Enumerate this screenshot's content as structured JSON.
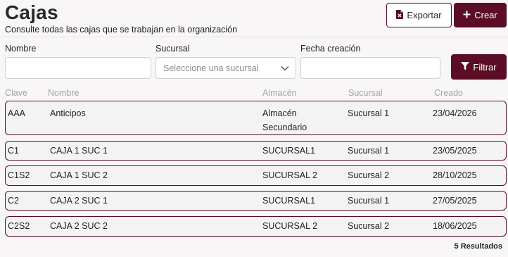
{
  "header": {
    "title": "Cajas",
    "subtitle": "Consulte todas las cajas que se trabajan en la organización",
    "export_label": "Exportar",
    "export_icon": "file-export-icon",
    "create_label": "Crear",
    "create_icon": "plus-icon"
  },
  "filters": {
    "nombre_label": "Nombre",
    "nombre_value": "",
    "sucursal_label": "Sucursal",
    "sucursal_placeholder": "Seleccione una sucursal",
    "fecha_label": "Fecha creación",
    "fecha_value": "",
    "filter_button_label": "Filtrar",
    "filter_icon": "funnel-icon"
  },
  "table": {
    "columns": [
      "Clave",
      "Nombre",
      "Almacén",
      "Sucursal",
      "Creado"
    ],
    "rows": [
      {
        "clave": "AAA",
        "nombre": "Anticipos",
        "almacen": "Almacén Secundario",
        "sucursal": "Sucursal 1",
        "creado": "23/04/2026"
      },
      {
        "clave": "C1",
        "nombre": "CAJA 1 SUC 1",
        "almacen": "SUCURSAL1",
        "sucursal": "Sucursal 1",
        "creado": "23/05/2025"
      },
      {
        "clave": "C1S2",
        "nombre": "CAJA 1 SUC 2",
        "almacen": "SUCURSAL 2",
        "sucursal": "Sucursal 2",
        "creado": "28/10/2025"
      },
      {
        "clave": "C2",
        "nombre": "CAJA 2 SUC 1",
        "almacen": "SUCURSAL1",
        "sucursal": "Sucursal 1",
        "creado": "27/05/2025"
      },
      {
        "clave": "C2S2",
        "nombre": "CAJA 2 SUC 2",
        "almacen": "SUCURSAL 2",
        "sucursal": "Sucursal 2",
        "creado": "18/06/2025"
      }
    ]
  },
  "footer": {
    "results_label": "5 Resultados"
  },
  "colors": {
    "accent": "#5a0d24",
    "background": "#f8f6f7",
    "row_background": "#f4f3f3"
  }
}
